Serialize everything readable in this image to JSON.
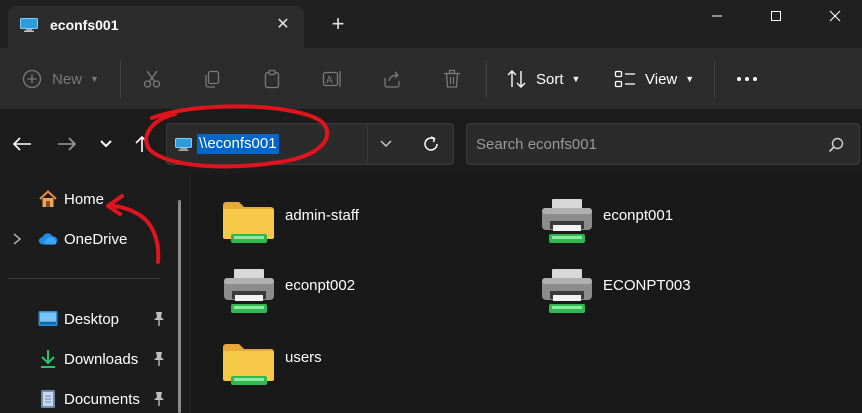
{
  "window": {
    "tab_title": "econfs001",
    "tab_icon": "monitor-icon",
    "new_tab_icon": "plus-icon",
    "close_tab_icon": "close-icon"
  },
  "toolbar": {
    "new_label": "New",
    "sort_label": "Sort",
    "view_label": "View",
    "more_icon": "more-icon"
  },
  "navigation": {
    "address_path": "\\\\econfs001",
    "search_placeholder": "Search econfs001"
  },
  "sidebar": {
    "items": [
      {
        "label": "Home",
        "icon": "home-icon"
      },
      {
        "label": "OneDrive",
        "icon": "cloud-icon"
      },
      {
        "label": "Desktop",
        "icon": "desktop-folder-icon",
        "pinned": true
      },
      {
        "label": "Downloads",
        "icon": "download-icon",
        "pinned": true
      },
      {
        "label": "Documents",
        "icon": "document-icon",
        "pinned": true
      }
    ]
  },
  "content": {
    "items": [
      {
        "name": "admin-staff",
        "type": "shared-folder"
      },
      {
        "name": "econpt001",
        "type": "printer"
      },
      {
        "name": "econpt002",
        "type": "printer"
      },
      {
        "name": "ECONPT003",
        "type": "printer"
      },
      {
        "name": "users",
        "type": "shared-folder"
      }
    ]
  },
  "colors": {
    "background": "#1c1c1c",
    "toolbar": "#2c2c2c",
    "selection": "#0066cc",
    "annotation": "#e0141c"
  }
}
